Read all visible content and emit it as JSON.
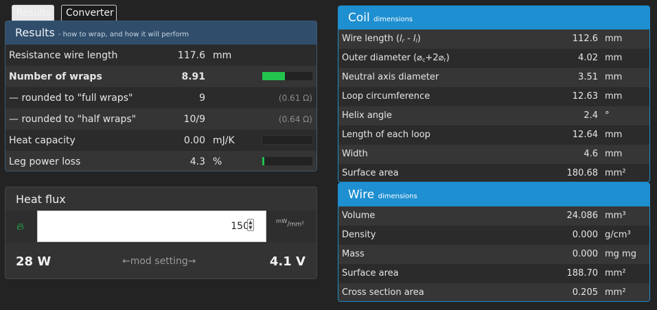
{
  "tabs": {
    "results": "Results",
    "converter": "Converter"
  },
  "results": {
    "title": "Results",
    "subtitle": "- how to wrap, and how it will perform",
    "rows": [
      {
        "label": "Resistance wire length",
        "value": "117.6",
        "unit": "mm"
      },
      {
        "label": "Number of wraps",
        "value": "8.91",
        "bar": 0.45
      },
      {
        "label": "— rounded to \"full wraps\"",
        "value": "9",
        "extra": "(0.61 Ω)"
      },
      {
        "label": "— rounded to \"half wraps\"",
        "value": "10/9",
        "extra": "(0.64 Ω)"
      },
      {
        "label": "Heat capacity",
        "value": "0.00",
        "unit": "mJ/K",
        "bar": 0.0
      },
      {
        "label": "Leg power loss",
        "value": "4.3",
        "unit": "%",
        "bar": 0.04
      }
    ]
  },
  "heat_flux": {
    "title": "Heat flux",
    "input_value": "150",
    "unit_num": "mW",
    "unit_den": "mm²",
    "watts": "28 W",
    "mod_setting": "←mod setting→",
    "volts": "4.1 V"
  },
  "coil": {
    "title": "Coil",
    "subtitle": "dimensions",
    "rows": [
      {
        "label": "Wire length (lr - ll)",
        "value": "112.6",
        "unit": "mm"
      },
      {
        "label": "Outer diameter (⌀c+2⌀r)",
        "value": "4.02",
        "unit": "mm"
      },
      {
        "label": "Neutral axis diameter",
        "value": "3.51",
        "unit": "mm"
      },
      {
        "label": "Loop circumference",
        "value": "12.63",
        "unit": "mm"
      },
      {
        "label": "Helix angle",
        "value": "2.4",
        "unit": "°"
      },
      {
        "label": "Length of each loop",
        "value": "12.64",
        "unit": "mm"
      },
      {
        "label": "Width",
        "value": "4.6",
        "unit": "mm"
      },
      {
        "label": "Surface area",
        "value": "180.68",
        "unit": "mm²"
      }
    ]
  },
  "wire": {
    "title": "Wire",
    "subtitle": "dimensions",
    "rows": [
      {
        "label": "Volume",
        "value": "24.086",
        "unit": "mm³"
      },
      {
        "label": "Density",
        "value": "0.000",
        "unit": "g/cm³"
      },
      {
        "label": "Mass",
        "value": "0.000",
        "unit": "mg mg"
      },
      {
        "label": "Surface area",
        "value": "188.70",
        "unit": "mm²"
      },
      {
        "label": "Cross section area",
        "value": "0.205",
        "unit": "mm²"
      }
    ]
  },
  "colors": {
    "accent_blue": "#1e8fd0",
    "header_navy": "#304e6b",
    "bar_green": "#22c44e"
  }
}
